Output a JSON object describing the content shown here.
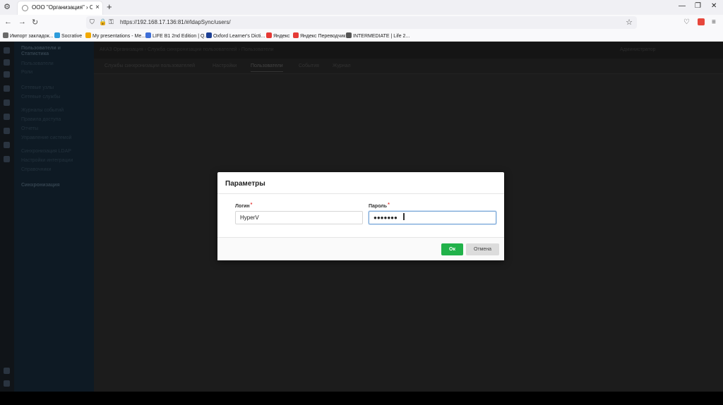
{
  "browser": {
    "tab_title": "ООО \"Организация\" › Служба",
    "url": "https://192.168.17.136:81/#/ldapSync/users/",
    "bookmarks": [
      {
        "label": "Импорт закладок...",
        "color": "#6a6a6a"
      },
      {
        "label": "Socrative",
        "color": "#2d9cdb"
      },
      {
        "label": "My presentations - Me...",
        "color": "#f2a900"
      },
      {
        "label": "LIFE B1 2nd Edition | Q...",
        "color": "#3e6fd8"
      },
      {
        "label": "Oxford Learner's Dicti...",
        "color": "#1c3f94"
      },
      {
        "label": "Яндекс",
        "color": "#e53935"
      },
      {
        "label": "Яндекс Переводчик",
        "color": "#e53935"
      },
      {
        "label": "INTERMEDIATE | Life 2...",
        "color": "#555555"
      }
    ]
  },
  "app": {
    "sidebar": {
      "items": [
        "Пользователи и",
        "Статистика",
        "Пользователи",
        "Роли",
        "Сетевые узлы",
        "Сетевые службы",
        "Журналы событий",
        "Правила доступа",
        "Отчеты",
        "Управление системой",
        "Синхронизация LDAP",
        "Настройки интеграции",
        "Справочники",
        "Синхронизация"
      ]
    },
    "breadcrumb": "АКАЗ Организация  ›  Служба синхронизации пользователей  ›  Пользователи",
    "user": "Администратор",
    "tabs": [
      "Службы синхронизации пользователей",
      "Настройки",
      "Пользователи",
      "События",
      "Журнал"
    ]
  },
  "dialog": {
    "title": "Параметры",
    "login_label": "Логин",
    "login_value": "HyperV",
    "password_label": "Пароль",
    "password_value": "●●●●●●●",
    "ok_label": "Ок",
    "cancel_label": "Отмена",
    "ok_color": "#21b24a"
  }
}
